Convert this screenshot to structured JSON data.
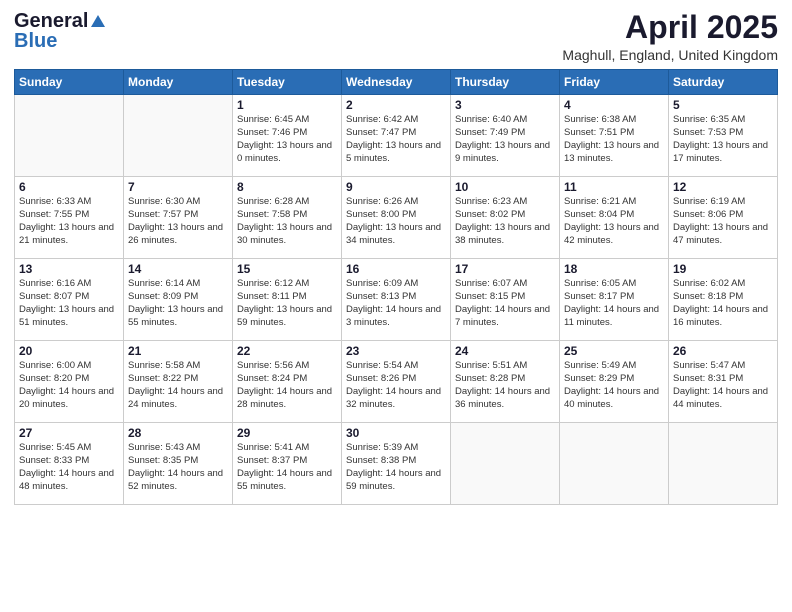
{
  "logo": {
    "general": "General",
    "blue": "Blue"
  },
  "title": "April 2025",
  "location": "Maghull, England, United Kingdom",
  "days_of_week": [
    "Sunday",
    "Monday",
    "Tuesday",
    "Wednesday",
    "Thursday",
    "Friday",
    "Saturday"
  ],
  "weeks": [
    [
      {
        "day": "",
        "info": ""
      },
      {
        "day": "",
        "info": ""
      },
      {
        "day": "1",
        "info": "Sunrise: 6:45 AM\nSunset: 7:46 PM\nDaylight: 13 hours and 0 minutes."
      },
      {
        "day": "2",
        "info": "Sunrise: 6:42 AM\nSunset: 7:47 PM\nDaylight: 13 hours and 5 minutes."
      },
      {
        "day": "3",
        "info": "Sunrise: 6:40 AM\nSunset: 7:49 PM\nDaylight: 13 hours and 9 minutes."
      },
      {
        "day": "4",
        "info": "Sunrise: 6:38 AM\nSunset: 7:51 PM\nDaylight: 13 hours and 13 minutes."
      },
      {
        "day": "5",
        "info": "Sunrise: 6:35 AM\nSunset: 7:53 PM\nDaylight: 13 hours and 17 minutes."
      }
    ],
    [
      {
        "day": "6",
        "info": "Sunrise: 6:33 AM\nSunset: 7:55 PM\nDaylight: 13 hours and 21 minutes."
      },
      {
        "day": "7",
        "info": "Sunrise: 6:30 AM\nSunset: 7:57 PM\nDaylight: 13 hours and 26 minutes."
      },
      {
        "day": "8",
        "info": "Sunrise: 6:28 AM\nSunset: 7:58 PM\nDaylight: 13 hours and 30 minutes."
      },
      {
        "day": "9",
        "info": "Sunrise: 6:26 AM\nSunset: 8:00 PM\nDaylight: 13 hours and 34 minutes."
      },
      {
        "day": "10",
        "info": "Sunrise: 6:23 AM\nSunset: 8:02 PM\nDaylight: 13 hours and 38 minutes."
      },
      {
        "day": "11",
        "info": "Sunrise: 6:21 AM\nSunset: 8:04 PM\nDaylight: 13 hours and 42 minutes."
      },
      {
        "day": "12",
        "info": "Sunrise: 6:19 AM\nSunset: 8:06 PM\nDaylight: 13 hours and 47 minutes."
      }
    ],
    [
      {
        "day": "13",
        "info": "Sunrise: 6:16 AM\nSunset: 8:07 PM\nDaylight: 13 hours and 51 minutes."
      },
      {
        "day": "14",
        "info": "Sunrise: 6:14 AM\nSunset: 8:09 PM\nDaylight: 13 hours and 55 minutes."
      },
      {
        "day": "15",
        "info": "Sunrise: 6:12 AM\nSunset: 8:11 PM\nDaylight: 13 hours and 59 minutes."
      },
      {
        "day": "16",
        "info": "Sunrise: 6:09 AM\nSunset: 8:13 PM\nDaylight: 14 hours and 3 minutes."
      },
      {
        "day": "17",
        "info": "Sunrise: 6:07 AM\nSunset: 8:15 PM\nDaylight: 14 hours and 7 minutes."
      },
      {
        "day": "18",
        "info": "Sunrise: 6:05 AM\nSunset: 8:17 PM\nDaylight: 14 hours and 11 minutes."
      },
      {
        "day": "19",
        "info": "Sunrise: 6:02 AM\nSunset: 8:18 PM\nDaylight: 14 hours and 16 minutes."
      }
    ],
    [
      {
        "day": "20",
        "info": "Sunrise: 6:00 AM\nSunset: 8:20 PM\nDaylight: 14 hours and 20 minutes."
      },
      {
        "day": "21",
        "info": "Sunrise: 5:58 AM\nSunset: 8:22 PM\nDaylight: 14 hours and 24 minutes."
      },
      {
        "day": "22",
        "info": "Sunrise: 5:56 AM\nSunset: 8:24 PM\nDaylight: 14 hours and 28 minutes."
      },
      {
        "day": "23",
        "info": "Sunrise: 5:54 AM\nSunset: 8:26 PM\nDaylight: 14 hours and 32 minutes."
      },
      {
        "day": "24",
        "info": "Sunrise: 5:51 AM\nSunset: 8:28 PM\nDaylight: 14 hours and 36 minutes."
      },
      {
        "day": "25",
        "info": "Sunrise: 5:49 AM\nSunset: 8:29 PM\nDaylight: 14 hours and 40 minutes."
      },
      {
        "day": "26",
        "info": "Sunrise: 5:47 AM\nSunset: 8:31 PM\nDaylight: 14 hours and 44 minutes."
      }
    ],
    [
      {
        "day": "27",
        "info": "Sunrise: 5:45 AM\nSunset: 8:33 PM\nDaylight: 14 hours and 48 minutes."
      },
      {
        "day": "28",
        "info": "Sunrise: 5:43 AM\nSunset: 8:35 PM\nDaylight: 14 hours and 52 minutes."
      },
      {
        "day": "29",
        "info": "Sunrise: 5:41 AM\nSunset: 8:37 PM\nDaylight: 14 hours and 55 minutes."
      },
      {
        "day": "30",
        "info": "Sunrise: 5:39 AM\nSunset: 8:38 PM\nDaylight: 14 hours and 59 minutes."
      },
      {
        "day": "",
        "info": ""
      },
      {
        "day": "",
        "info": ""
      },
      {
        "day": "",
        "info": ""
      }
    ]
  ]
}
